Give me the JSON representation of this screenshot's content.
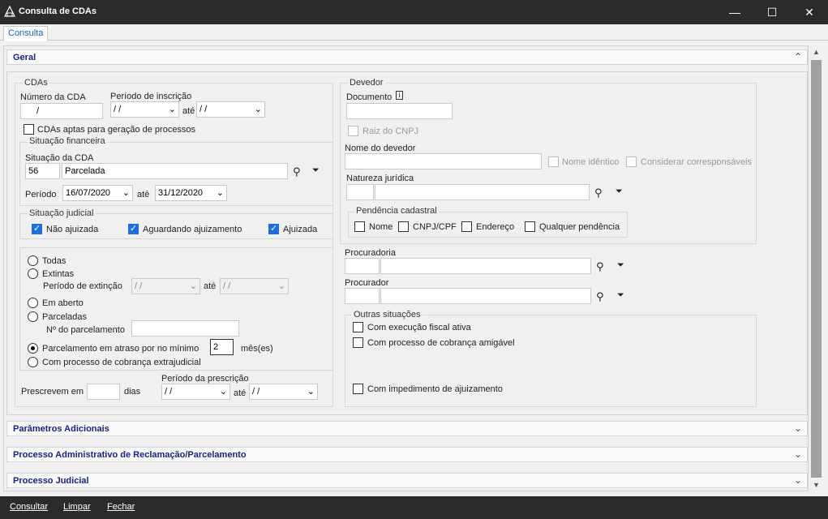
{
  "window": {
    "title": "Consulta de CDAs",
    "minimize": "—",
    "maximize": "☐",
    "close": "✕"
  },
  "tab": "Consulta",
  "sections": {
    "geral": "Geral",
    "parametros": "Parâmetros Adicionais",
    "processo_admin": "Processo Administrativo de Reclamação/Parcelamento",
    "processo_judicial": "Processo Judicial"
  },
  "cdas": {
    "group": "CDAs",
    "numero_label": "Número da CDA",
    "numero_value": "/",
    "periodo_inscricao_label": "Período de inscrição",
    "periodo_inscricao_de": "/ /",
    "ate": "até",
    "periodo_inscricao_ate": "/ /",
    "aptas_label": "CDAs aptas para geração de processos"
  },
  "situacao_financeira": {
    "group": "Situação financeira",
    "situacao_label": "Situação da CDA",
    "situacao_code": "56",
    "situacao_desc": "Parcelada",
    "periodo_label": "Período",
    "periodo_de": "16/07/2020",
    "ate": "até",
    "periodo_ate": "31/12/2020"
  },
  "situacao_judicial": {
    "group": "Situação judicial",
    "nao_ajuizada": "Não ajuizada",
    "aguardando": "Aguardando ajuizamento",
    "ajuizada": "Ajuizada"
  },
  "opcoes": {
    "todas": "Todas",
    "extintas": "Extintas",
    "periodo_extincao_label": "Período de extinção",
    "periodo_extincao_de": "/ /",
    "ate": "até",
    "periodo_extincao_ate": "/ /",
    "em_aberto": "Em aberto",
    "parceladas": "Parceladas",
    "num_parcelamento_label": "Nº do parcelamento",
    "atraso_label": "Parcelamento em atraso por no mínimo",
    "atraso_value": "2",
    "meses_label": "mês(es)",
    "cobranca_extrajudicial": "Com processo de cobrança extrajudicial"
  },
  "prescricao": {
    "prescrevem_label": "Prescrevem em",
    "dias_label": "dias",
    "periodo_label": "Período da prescrição",
    "de": "/ /",
    "ate": "até",
    "ate_value": "/ /"
  },
  "devedor": {
    "group": "Devedor",
    "documento_label": "Documento",
    "raiz_cnpj": "Raiz do CNPJ",
    "nome_label": "Nome do devedor",
    "nome_identico": "Nome idêntico",
    "considerar": "Considerar corresponsáveis",
    "natureza_label": "Natureza jurídica",
    "pendencia_group": "Pendência cadastral",
    "pend_nome": "Nome",
    "pend_cnpj": "CNPJ/CPF",
    "pend_endereco": "Endereço",
    "pend_qualquer": "Qualquer pendência"
  },
  "procuradoria_label": "Procuradoria",
  "procurador_label": "Procurador",
  "outras": {
    "group": "Outras situações",
    "execucao": "Com execução fiscal ativa",
    "cobranca_amigavel": "Com processo de cobrança amigável",
    "impedimento": "Com impedimento de ajuizamento"
  },
  "buttons": {
    "consultar": "Consultar",
    "limpar": "Limpar",
    "fechar": "Fechar"
  }
}
